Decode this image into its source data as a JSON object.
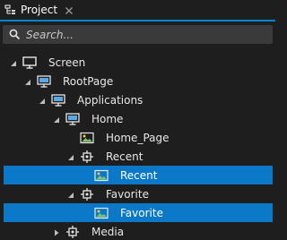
{
  "panel": {
    "tab_title": "Project",
    "tab_icon": "project-panel-icon",
    "close_icon": "close-icon",
    "accent_color": "#0086d1"
  },
  "search": {
    "placeholder": "Search...",
    "value": ""
  },
  "colors": {
    "background": "#1e1e1e",
    "search_background": "#3a3a3a",
    "selection": "#0b78c8",
    "text": "#e8e8e8"
  },
  "tree": {
    "items": [
      {
        "label": "Screen",
        "icon": "monitor-icon",
        "expander": "expanded",
        "selected": false
      },
      {
        "label": "RootPage",
        "icon": "page-monitor-icon",
        "expander": "expanded",
        "selected": false
      },
      {
        "label": "Applications",
        "icon": "page-monitor-icon",
        "expander": "expanded",
        "selected": false
      },
      {
        "label": "Home",
        "icon": "page-monitor-icon",
        "expander": "expanded",
        "selected": false
      },
      {
        "label": "Home_Page",
        "icon": "image-icon",
        "expander": "none",
        "selected": false
      },
      {
        "label": "Recent",
        "icon": "node-icon",
        "expander": "expanded",
        "selected": false
      },
      {
        "label": "Recent",
        "icon": "image-icon",
        "expander": "none",
        "selected": true
      },
      {
        "label": "Favorite",
        "icon": "node-icon",
        "expander": "expanded",
        "selected": false
      },
      {
        "label": "Favorite",
        "icon": "image-icon",
        "expander": "none",
        "selected": true
      },
      {
        "label": "Media",
        "icon": "node-icon",
        "expander": "collapsed",
        "selected": false
      }
    ]
  }
}
